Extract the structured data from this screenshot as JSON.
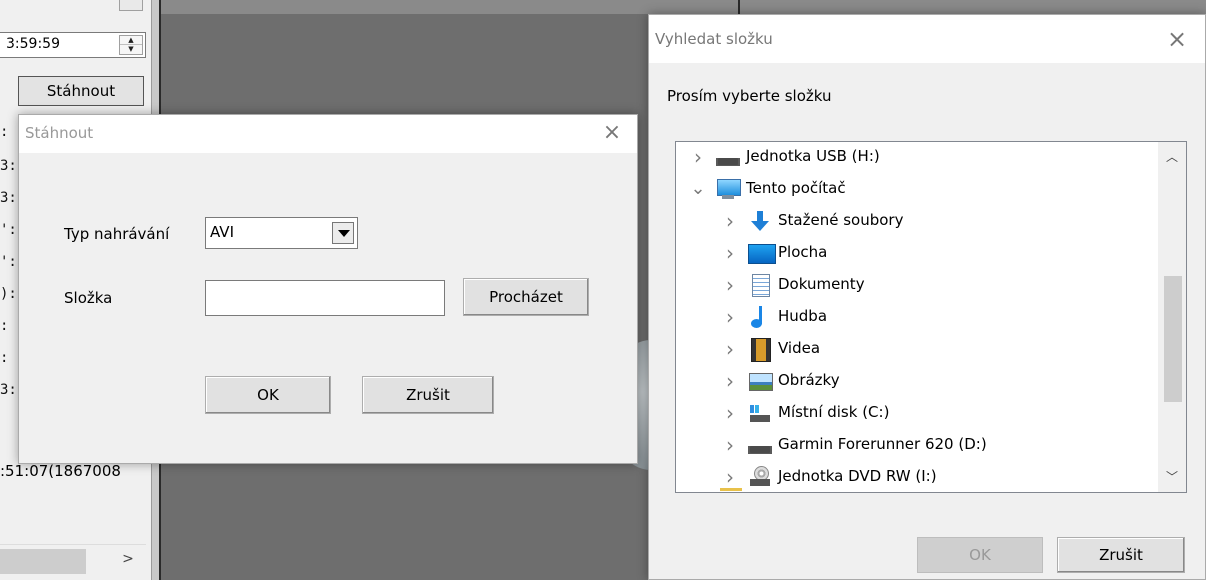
{
  "background_app": {
    "time_value": "3:59:59",
    "download_button": "Stáhnout",
    "list_rows": [
      ":",
      "3:",
      "3:",
      "':",
      "':",
      "):",
      ":",
      ":",
      "3:"
    ],
    "last_row": ":51:07(1867008",
    "scroll_right_arrow": ">"
  },
  "download_dialog": {
    "title": "Stáhnout",
    "close_glyph": "×",
    "record_type_label": "Typ nahrávání",
    "record_type_value": "AVI",
    "folder_label": "Složka",
    "folder_value": "",
    "browse_button": "Procházet",
    "ok_button": "OK",
    "cancel_button": "Zrušit"
  },
  "folder_dialog": {
    "title": "Vyhledat složku",
    "close_glyph": "×",
    "prompt": "Prosím vyberte složku",
    "tree": [
      {
        "label": "Jednotka USB (H:)",
        "icon": "usb-drive-icon",
        "expanded": false,
        "level": 0
      },
      {
        "label": "Tento počítač",
        "icon": "this-pc-icon",
        "expanded": true,
        "level": 0
      },
      {
        "label": "Stažené soubory",
        "icon": "downloads-icon",
        "expanded": false,
        "level": 1
      },
      {
        "label": "Plocha",
        "icon": "desktop-icon",
        "expanded": false,
        "level": 1
      },
      {
        "label": "Dokumenty",
        "icon": "documents-icon",
        "expanded": false,
        "level": 1
      },
      {
        "label": "Hudba",
        "icon": "music-icon",
        "expanded": false,
        "level": 1
      },
      {
        "label": "Videa",
        "icon": "videos-icon",
        "expanded": false,
        "level": 1
      },
      {
        "label": "Obrázky",
        "icon": "pictures-icon",
        "expanded": false,
        "level": 1
      },
      {
        "label": "Místní disk (C:)",
        "icon": "local-disk-icon",
        "expanded": false,
        "level": 1
      },
      {
        "label": "Garmin Forerunner 620 (D:)",
        "icon": "drive-icon",
        "expanded": false,
        "level": 1
      },
      {
        "label": "Jednotka DVD RW (I:)",
        "icon": "dvd-drive-icon",
        "expanded": false,
        "level": 1
      }
    ],
    "ok_button": "OK",
    "ok_enabled": false,
    "cancel_button": "Zrušit"
  }
}
